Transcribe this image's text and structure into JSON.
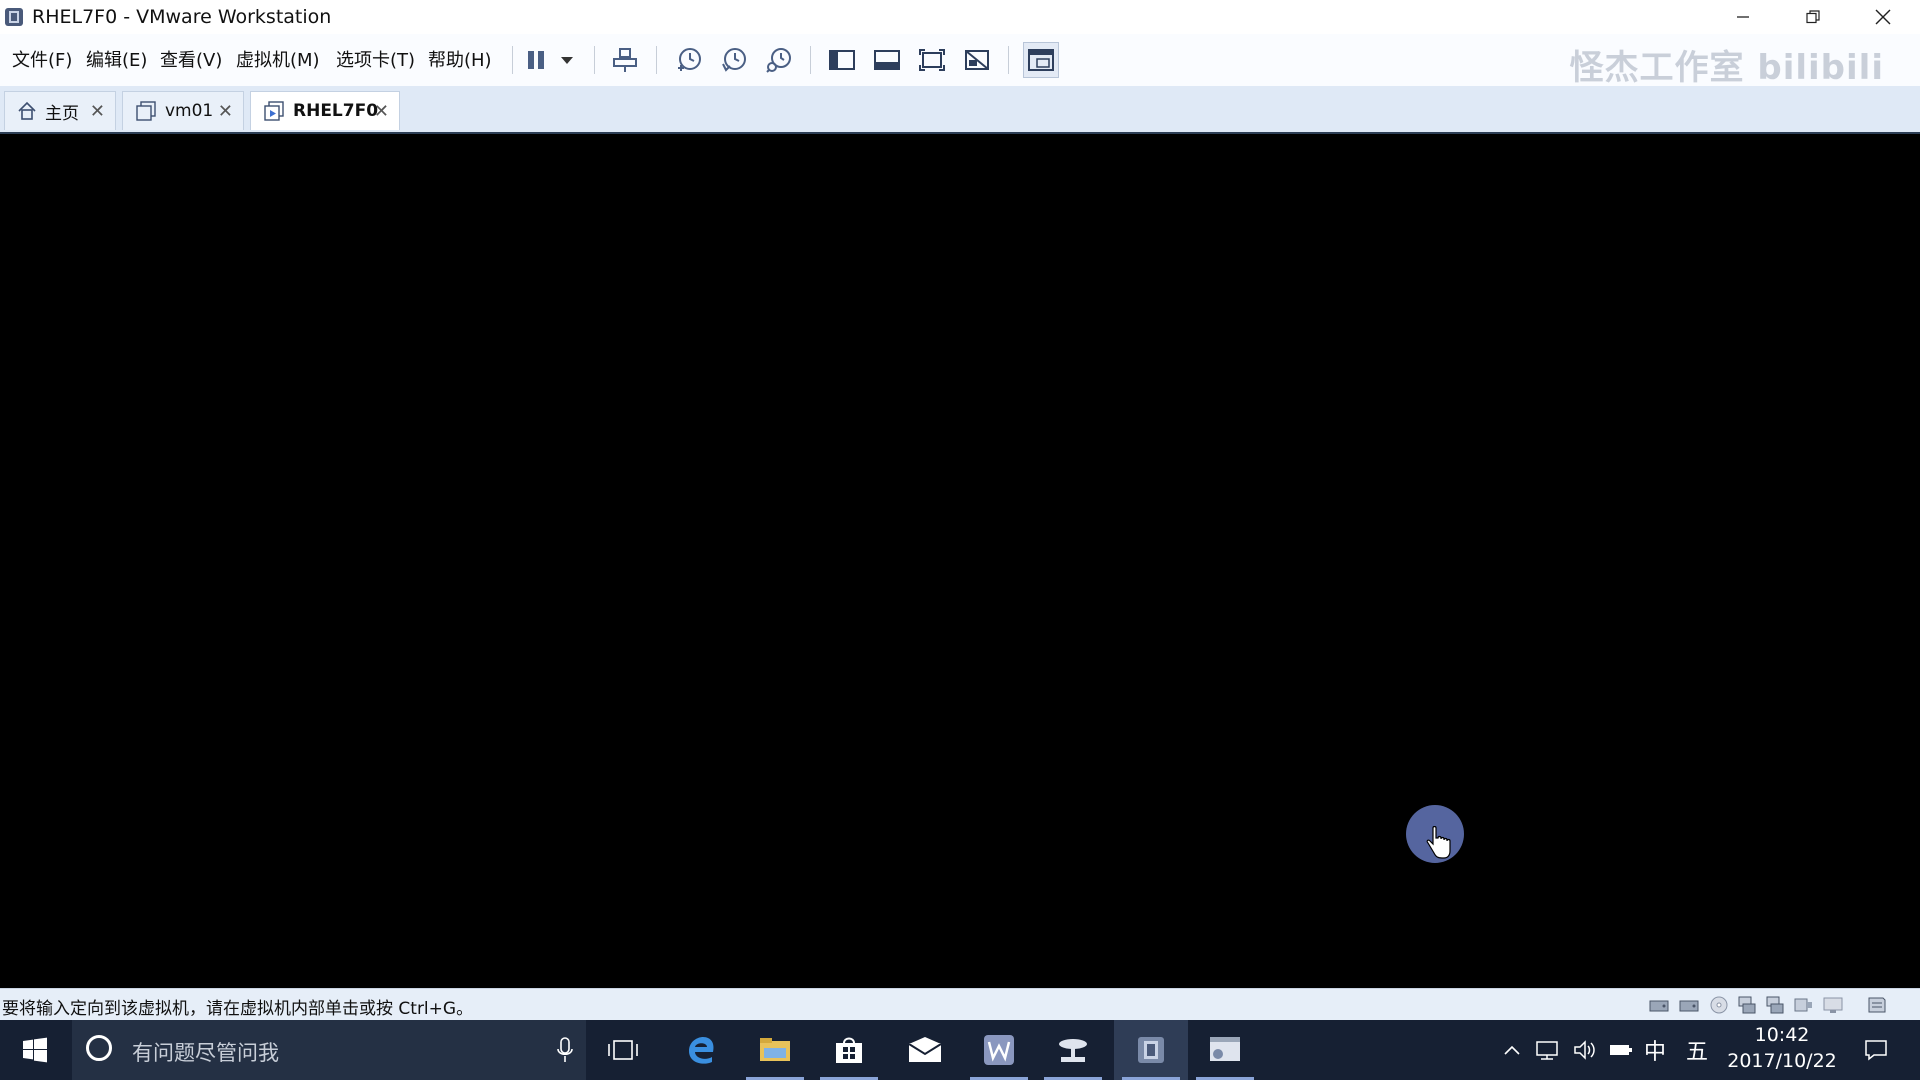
{
  "window": {
    "title": "RHEL7F0 - VMware Workstation",
    "controls": {
      "minimize": "—",
      "restore": "❐",
      "close": "✕"
    }
  },
  "menubar": {
    "items": [
      "文件(F)",
      "编辑(E)",
      "查看(V)",
      "虚拟机(M)",
      "选项卡(T)",
      "帮助(H)"
    ]
  },
  "toolbar": {
    "icons": [
      "pause-icon",
      "dropdown-arrow-icon",
      "send-ctrl-alt-del-icon",
      "snapshot-take-icon",
      "snapshot-revert-icon",
      "snapshot-manager-icon",
      "library-view-icon",
      "console-view-icon",
      "full-screen-icon",
      "unity-icon",
      "thumbnail-view-icon"
    ],
    "watermark": "怪杰工作室 bilibili"
  },
  "tabs": [
    {
      "label": "主页",
      "icon": "home-icon",
      "active": false
    },
    {
      "label": "vm01",
      "icon": "vm-icon",
      "active": false
    },
    {
      "label": "RHEL7F0",
      "icon": "vm-running-icon",
      "active": true
    }
  ],
  "statusbar": {
    "message": "要将输入定向到该虚拟机，请在虚拟机内部单击或按 Ctrl+G。",
    "device_icons": [
      "hard-disk-icon",
      "hard-disk-2-icon",
      "cd-dvd-icon",
      "network-adapter-icon",
      "network-adapter-2-icon",
      "usb-icon",
      "display-icon",
      "message-log-icon"
    ]
  },
  "taskbar": {
    "search_placeholder": "有问题尽管问我",
    "apps": [
      "task-view-icon",
      "edge-icon",
      "file-explorer-icon",
      "store-icon",
      "mail-icon",
      "wps-writer-icon",
      "network-tool-icon",
      "vmware-icon",
      "remote-desktop-icon"
    ],
    "tray": {
      "ime_lang": "中",
      "ime_mode": "五",
      "time": "10:42",
      "date": "2017/10/22"
    }
  },
  "colors": {
    "taskbar_bg": "#162033",
    "vm_screen_bg": "#000000",
    "tab_bar_bg": "#dfe9f6",
    "cursor_circle": "#5a6aa8"
  }
}
